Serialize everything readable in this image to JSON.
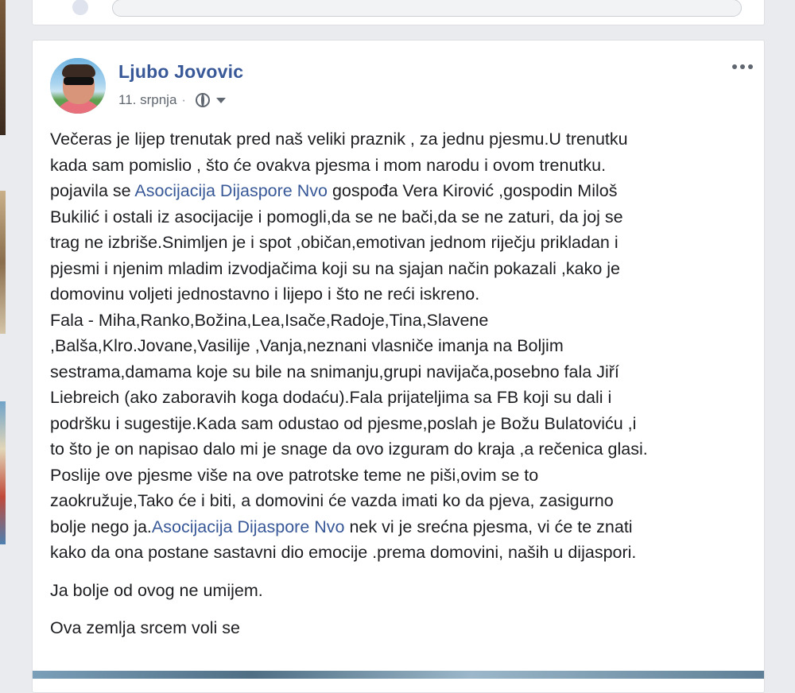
{
  "post": {
    "author": "Ljubo Jovovic",
    "date": "11. srpnja",
    "separator": "·",
    "privacy_icon": "globe-icon",
    "audience_icon": "caret-down-icon",
    "more_icon": "more-dots-icon",
    "paragraphs": [
      {
        "lines": [
          [
            {
              "t": "Večeras je lijep trenutak pred naš veliki praznik , za jednu pjesmu.U trenutku"
            }
          ],
          [
            {
              "t": "kada sam pomislio , što će ovakva pjesma i mom narodu i ovom trenutku."
            }
          ],
          [
            {
              "t": "pojavila se "
            },
            {
              "t": "Asocijacija Dijaspore Nvo",
              "link": true
            },
            {
              "t": " gospođa Vera Kirović ,gospodin Miloš"
            }
          ],
          [
            {
              "t": "Bukilić i ostali iz asocijacije i pomogli,da se ne bači,da se ne zaturi, da joj se"
            }
          ],
          [
            {
              "t": "trag ne izbriše.Snimljen je i spot ,običan,emotivan jednom riječju prikladan i"
            }
          ],
          [
            {
              "t": "pjesmi i njenim mladim izvodjačima koji su na sjajan način pokazali ,kako je"
            }
          ],
          [
            {
              "t": "domovinu voljeti jednostavno i lijepo i što ne reći iskreno."
            }
          ],
          [
            {
              "t": "Fala - Miha,Ranko,Božina,Lea,Isače,Radoje,Tina,Slavene"
            }
          ],
          [
            {
              "t": ",Balša,Klro.Jovane,Vasilije ,Vanja,neznani vlasniče imanja na Boljim"
            }
          ],
          [
            {
              "t": "sestrama,damama koje su bile na snimanju,grupi navijača,posebno fala Jiří"
            }
          ],
          [
            {
              "t": "Liebreich (ako zaboravih koga dodaću).Fala prijateljima sa FB koji su dali i"
            }
          ],
          [
            {
              "t": "podršku i sugestije.Kada sam odustao od pjesme,poslah je Božu Bulatoviću ,i"
            }
          ],
          [
            {
              "t": "to što je on napisao dalo mi je snage da ovo izguram do kraja ,a rečenica glasi."
            }
          ],
          [
            {
              "t": "Poslije ove pjesme više na ove patrotske teme ne piši,ovim se to"
            }
          ],
          [
            {
              "t": "zaokružuje,Tako će i biti, a domovini će vazda imati ko da pjeva, zasigurno"
            }
          ],
          [
            {
              "t": "bolje nego ja."
            },
            {
              "t": "Asocijacija Dijaspore Nvo",
              "link": true
            },
            {
              "t": " nek vi je srećna pjesma, vi će te znati"
            }
          ],
          [
            {
              "t": "kako da ona postane sastavni dio emocije .prema domovini, naših u dijaspori."
            }
          ]
        ]
      },
      {
        "lines": [
          [
            {
              "t": "Ja bolje od ovog ne umijem."
            }
          ]
        ]
      },
      {
        "lines": [
          [
            {
              "t": "Ova zemlja srcem voli se"
            }
          ]
        ]
      }
    ]
  },
  "colors": {
    "background": "#e9ebee",
    "card": "#ffffff",
    "link": "#385898",
    "text": "#1c1e21",
    "meta": "#606770"
  }
}
